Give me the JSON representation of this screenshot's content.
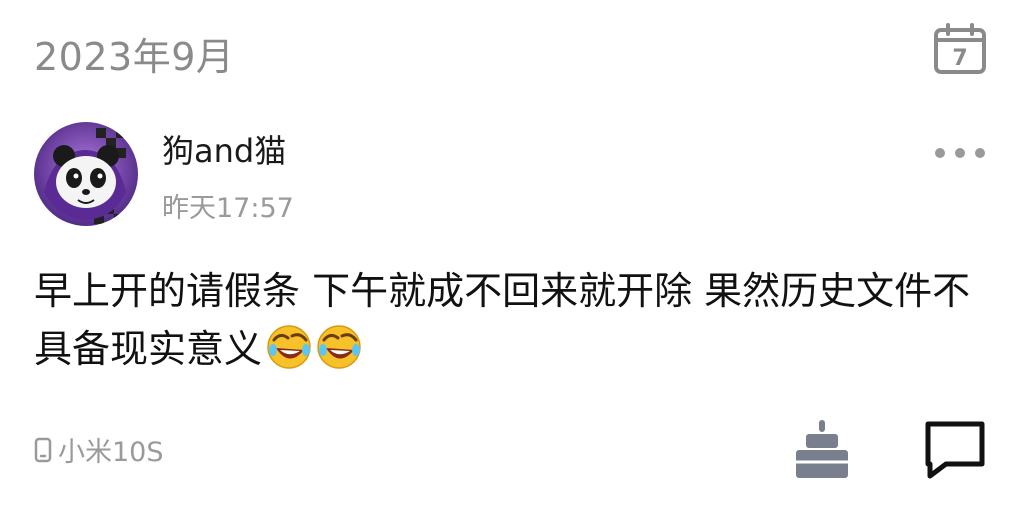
{
  "header": {
    "month": "2023年9月",
    "calendar_day": "7"
  },
  "post": {
    "username": "狗and猫",
    "time": "昨天17:57",
    "text": "早上开的请假条 下午就成不回来就开除 果然历史文件不具备现实意义",
    "emojis": [
      "laugh-cry-emoji",
      "laugh-cry-emoji"
    ],
    "device": "小米10S"
  },
  "icons": {
    "calendar": "calendar-icon",
    "more": "more-dots-icon",
    "device": "phone-icon",
    "cake": "cake-icon",
    "comment": "comment-icon"
  },
  "colors": {
    "text_primary": "#111111",
    "text_secondary": "#9a9a9a",
    "icon_gray": "#8a8a8a",
    "avatar_purple": "#6b3fa0"
  }
}
